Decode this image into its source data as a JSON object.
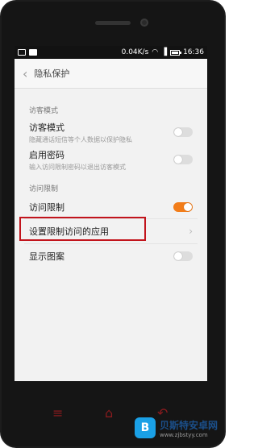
{
  "status_bar": {
    "speed": "0.04K/s",
    "time": "16:36"
  },
  "header": {
    "back_icon": "chevron-left",
    "title": "隐私保护"
  },
  "sections": [
    {
      "label": "访客模式",
      "rows": [
        {
          "label": "访客模式",
          "desc": "隐藏通话短信等个人数据以保护隐私",
          "toggle": "off"
        },
        {
          "label": "启用密码",
          "desc": "输入访问限制密码以退出访客模式",
          "toggle": "off"
        }
      ]
    },
    {
      "label": "访问限制",
      "rows": [
        {
          "label": "访问限制",
          "toggle": "on"
        },
        {
          "label": "设置限制访问的应用",
          "chevron": "chevron-right"
        },
        {
          "label": "显示图案",
          "toggle": "off"
        }
      ]
    }
  ],
  "watermark": {
    "title": "贝斯特安卓网",
    "url": "www.zjbstyy.com"
  },
  "colors": {
    "accent": "#f27d1a",
    "highlight": "#c2141c",
    "nav": "#8a1b1e"
  }
}
